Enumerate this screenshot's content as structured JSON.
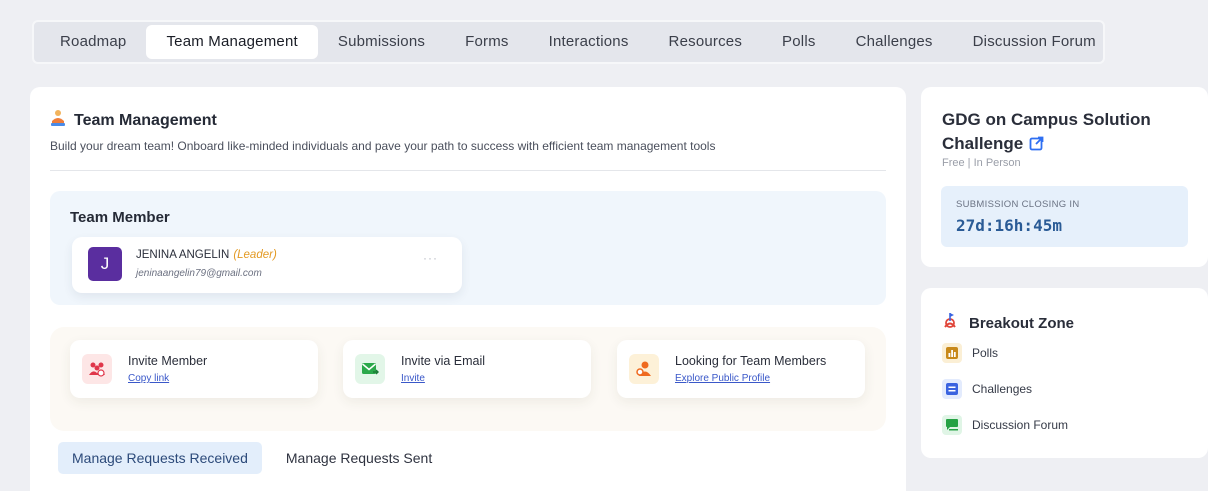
{
  "tabs": [
    {
      "label": "Roadmap",
      "active": false
    },
    {
      "label": "Team Management",
      "active": true
    },
    {
      "label": "Submissions",
      "active": false
    },
    {
      "label": "Forms",
      "active": false
    },
    {
      "label": "Interactions",
      "active": false
    },
    {
      "label": "Resources",
      "active": false
    },
    {
      "label": "Polls",
      "active": false
    },
    {
      "label": "Challenges",
      "active": false
    },
    {
      "label": "Discussion Forum",
      "active": false
    }
  ],
  "main": {
    "title": "Team Management",
    "title_icon": "team-person-icon",
    "subtitle": "Build your dream team! Onboard like-minded individuals and pave your path to success with efficient team management tools",
    "team_member": {
      "header": "Team Member",
      "initial": "J",
      "name": "JENINA ANGELIN",
      "role": "(Leader)",
      "email": "jeninaangelin79@gmail.com",
      "more": "···"
    },
    "actions": [
      {
        "title": "Invite Member",
        "link": "Copy link",
        "icon": "group-icon",
        "icon_bg": "#fde6e6",
        "icon_color": "#e0364a"
      },
      {
        "title": "Invite via Email",
        "link": "Invite",
        "icon": "email-icon",
        "icon_bg": "#e2f6e8",
        "icon_color": "#2aa84a"
      },
      {
        "title": "Looking for Team Members",
        "link": "Explore Public Profile",
        "icon": "search-user-icon",
        "icon_bg": "#fdf1d8",
        "icon_color": "#ef6a1f"
      }
    ],
    "request_tabs": [
      {
        "label": "Manage Requests Received",
        "active": true
      },
      {
        "label": "Manage Requests Sent",
        "active": false
      }
    ]
  },
  "challenge": {
    "title": "GDG on Campus Solution Challenge",
    "meta": "Free | In Person",
    "closing_label": "SUBMISSION CLOSING IN",
    "countdown": "27d:16h:45m"
  },
  "breakout": {
    "title": "Breakout Zone",
    "items": [
      {
        "label": "Polls",
        "icon": "poll-icon",
        "color": "#c8891a",
        "bg": "#fbefd5"
      },
      {
        "label": "Challenges",
        "icon": "list-icon",
        "color": "#3a63e0",
        "bg": "#e3ebfd"
      },
      {
        "label": "Discussion Forum",
        "icon": "chat-icon",
        "color": "#26a244",
        "bg": "#e0f5e6"
      }
    ]
  }
}
